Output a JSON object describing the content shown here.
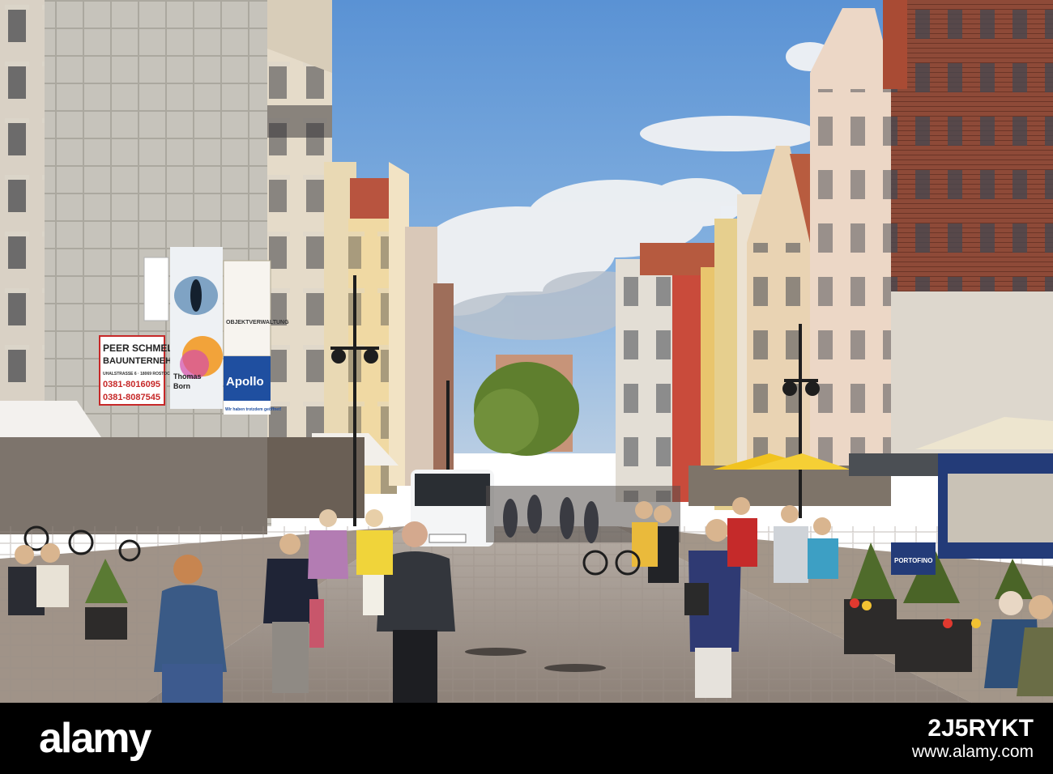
{
  "signs": {
    "contractor_line1": "PEER SCHMELZER",
    "contractor_line2": "BAUUNTERNEHMEN",
    "contractor_address": "UHALSTRASSE 6 · 18069 ROSTOCK",
    "contractor_phone1": "0381-8016095",
    "contractor_phone2": "0381-8087545",
    "eye_banner_name": "Thomas",
    "eye_banner_name2": "Born",
    "objekt_banner": "OBJEKTVERWALTUNG",
    "apollo": "Apollo",
    "apollo_slogan": "Wir haben trotzdem geöffnet!",
    "portofino": "PORTOFINO"
  },
  "footer": {
    "logo": "alamy",
    "image_id": "2J5RYKT",
    "url": "www.alamy.com"
  },
  "colors": {
    "sky": "#6d9fd6",
    "footer_bg": "#000000",
    "footer_text": "#ffffff"
  }
}
